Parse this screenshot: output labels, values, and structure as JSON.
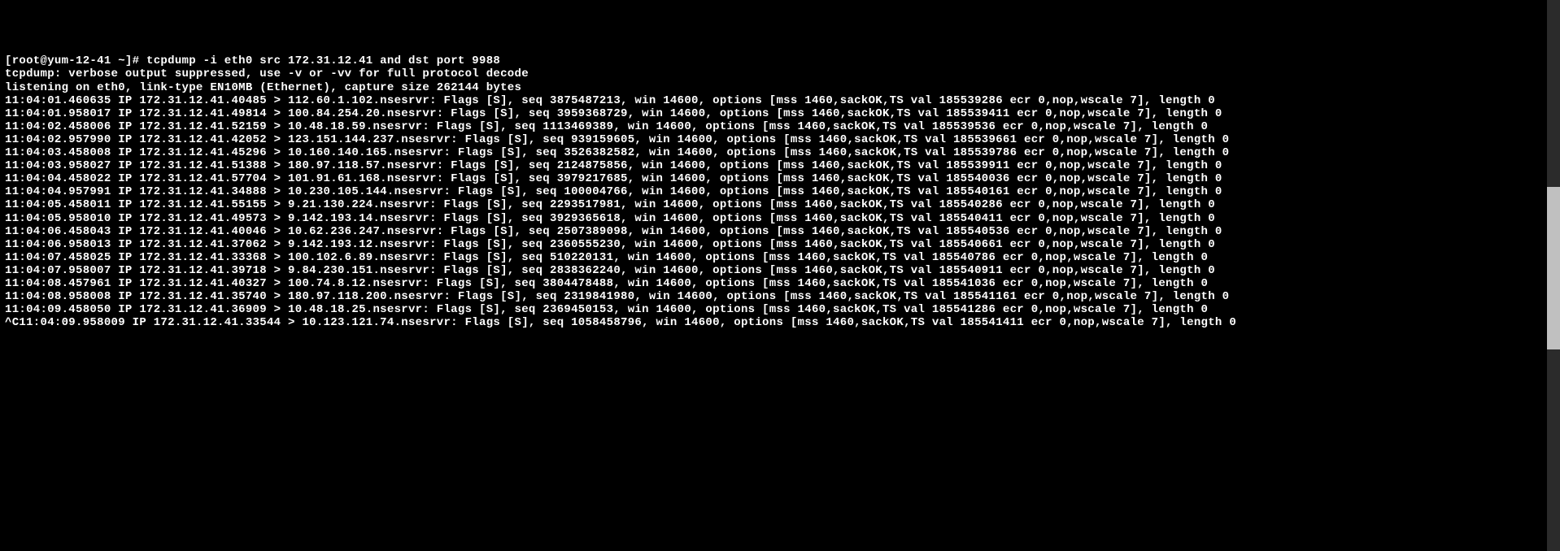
{
  "terminal": {
    "prompt": "[root@yum-12-41 ~]# ",
    "command": "tcpdump -i eth0 src 172.31.12.41 and dst port 9988",
    "header1": "tcpdump: verbose output suppressed, use -v or -vv for full protocol decode",
    "header2": "listening on eth0, link-type EN10MB (Ethernet), capture size 262144 bytes",
    "lines": [
      "11:04:01.460635 IP 172.31.12.41.40485 > 112.60.1.102.nsesrvr: Flags [S], seq 3875487213, win 14600, options [mss 1460,sackOK,TS val 185539286 ecr 0,nop,wscale 7], length 0",
      "11:04:01.958017 IP 172.31.12.41.49814 > 100.84.254.20.nsesrvr: Flags [S], seq 3959368729, win 14600, options [mss 1460,sackOK,TS val 185539411 ecr 0,nop,wscale 7], length 0",
      "11:04:02.458006 IP 172.31.12.41.52159 > 10.48.18.59.nsesrvr: Flags [S], seq 1113469389, win 14600, options [mss 1460,sackOK,TS val 185539536 ecr 0,nop,wscale 7], length 0",
      "11:04:02.957990 IP 172.31.12.41.42052 > 123.151.144.237.nsesrvr: Flags [S], seq 939159605, win 14600, options [mss 1460,sackOK,TS val 185539661 ecr 0,nop,wscale 7], length 0",
      "11:04:03.458008 IP 172.31.12.41.45296 > 10.160.140.165.nsesrvr: Flags [S], seq 3526382582, win 14600, options [mss 1460,sackOK,TS val 185539786 ecr 0,nop,wscale 7], length 0",
      "11:04:03.958027 IP 172.31.12.41.51388 > 180.97.118.57.nsesrvr: Flags [S], seq 2124875856, win 14600, options [mss 1460,sackOK,TS val 185539911 ecr 0,nop,wscale 7], length 0",
      "11:04:04.458022 IP 172.31.12.41.57704 > 101.91.61.168.nsesrvr: Flags [S], seq 3979217685, win 14600, options [mss 1460,sackOK,TS val 185540036 ecr 0,nop,wscale 7], length 0",
      "11:04:04.957991 IP 172.31.12.41.34888 > 10.230.105.144.nsesrvr: Flags [S], seq 100004766, win 14600, options [mss 1460,sackOK,TS val 185540161 ecr 0,nop,wscale 7], length 0",
      "11:04:05.458011 IP 172.31.12.41.55155 > 9.21.130.224.nsesrvr: Flags [S], seq 2293517981, win 14600, options [mss 1460,sackOK,TS val 185540286 ecr 0,nop,wscale 7], length 0",
      "11:04:05.958010 IP 172.31.12.41.49573 > 9.142.193.14.nsesrvr: Flags [S], seq 3929365618, win 14600, options [mss 1460,sackOK,TS val 185540411 ecr 0,nop,wscale 7], length 0",
      "11:04:06.458043 IP 172.31.12.41.40046 > 10.62.236.247.nsesrvr: Flags [S], seq 2507389098, win 14600, options [mss 1460,sackOK,TS val 185540536 ecr 0,nop,wscale 7], length 0",
      "11:04:06.958013 IP 172.31.12.41.37062 > 9.142.193.12.nsesrvr: Flags [S], seq 2360555230, win 14600, options [mss 1460,sackOK,TS val 185540661 ecr 0,nop,wscale 7], length 0",
      "11:04:07.458025 IP 172.31.12.41.33368 > 100.102.6.89.nsesrvr: Flags [S], seq 510220131, win 14600, options [mss 1460,sackOK,TS val 185540786 ecr 0,nop,wscale 7], length 0",
      "11:04:07.958007 IP 172.31.12.41.39718 > 9.84.230.151.nsesrvr: Flags [S], seq 2838362240, win 14600, options [mss 1460,sackOK,TS val 185540911 ecr 0,nop,wscale 7], length 0",
      "11:04:08.457961 IP 172.31.12.41.40327 > 100.74.8.12.nsesrvr: Flags [S], seq 3804478488, win 14600, options [mss 1460,sackOK,TS val 185541036 ecr 0,nop,wscale 7], length 0",
      "11:04:08.958008 IP 172.31.12.41.35740 > 180.97.118.200.nsesrvr: Flags [S], seq 2319841980, win 14600, options [mss 1460,sackOK,TS val 185541161 ecr 0,nop,wscale 7], length 0",
      "11:04:09.458050 IP 172.31.12.41.36909 > 10.48.18.25.nsesrvr: Flags [S], seq 2369450153, win 14600, options [mss 1460,sackOK,TS val 185541286 ecr 0,nop,wscale 7], length 0",
      "^C11:04:09.958009 IP 172.31.12.41.33544 > 10.123.121.74.nsesrvr: Flags [S], seq 1058458796, win 14600, options [mss 1460,sackOK,TS val 185541411 ecr 0,nop,wscale 7], length 0"
    ]
  }
}
